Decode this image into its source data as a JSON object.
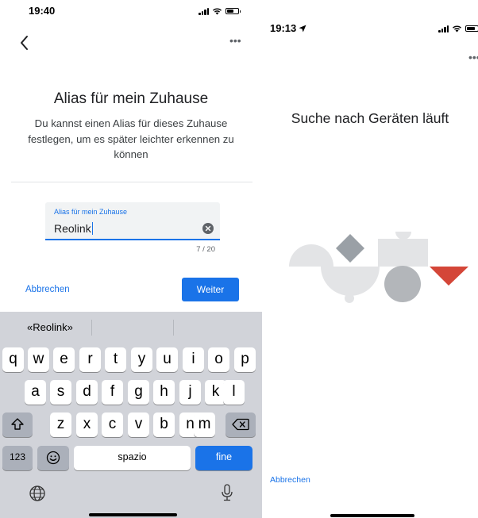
{
  "left_screen": {
    "status_time": "19:40",
    "more_glyph": "•••",
    "title": "Alias für mein Zuhause",
    "subtitle": "Du kannst einen Alias für dieses Zuhause festlegen, um es später leichter erkennen zu können",
    "field": {
      "label": "Alias für mein Zuhause",
      "value": "Reolink",
      "counter": "7 / 20"
    },
    "cancel_label": "Abbrechen",
    "next_label": "Weiter",
    "keyboard": {
      "suggestion": "«Reolink»",
      "row1": [
        "q",
        "w",
        "e",
        "r",
        "t",
        "y",
        "u",
        "i",
        "o",
        "p"
      ],
      "row2": [
        "a",
        "s",
        "d",
        "f",
        "g",
        "h",
        "j",
        "k",
        "l"
      ],
      "row3": [
        "z",
        "x",
        "c",
        "v",
        "b",
        "n",
        "m"
      ],
      "numbers_label": "123",
      "space_label": "spazio",
      "enter_label": "fine"
    }
  },
  "right_screen": {
    "status_time": "19:13",
    "more_glyph": "•••",
    "title": "Suche nach Geräten läuft",
    "cancel_label": "Abbrechen"
  },
  "icons": {
    "back": "chevron-left-icon",
    "more": "more-horizontal-icon",
    "clear": "clear-circle-icon",
    "shift": "shift-icon",
    "backspace": "backspace-icon",
    "emoji": "emoji-icon",
    "globe": "globe-icon",
    "mic": "microphone-icon",
    "location": "location-arrow-icon"
  },
  "colors": {
    "accent": "#1a73e8",
    "keyboard_bg": "#d1d3d9",
    "shape_light": "#e3e4e6",
    "shape_mid": "#9aa0a6",
    "shape_red": "#d44638"
  }
}
